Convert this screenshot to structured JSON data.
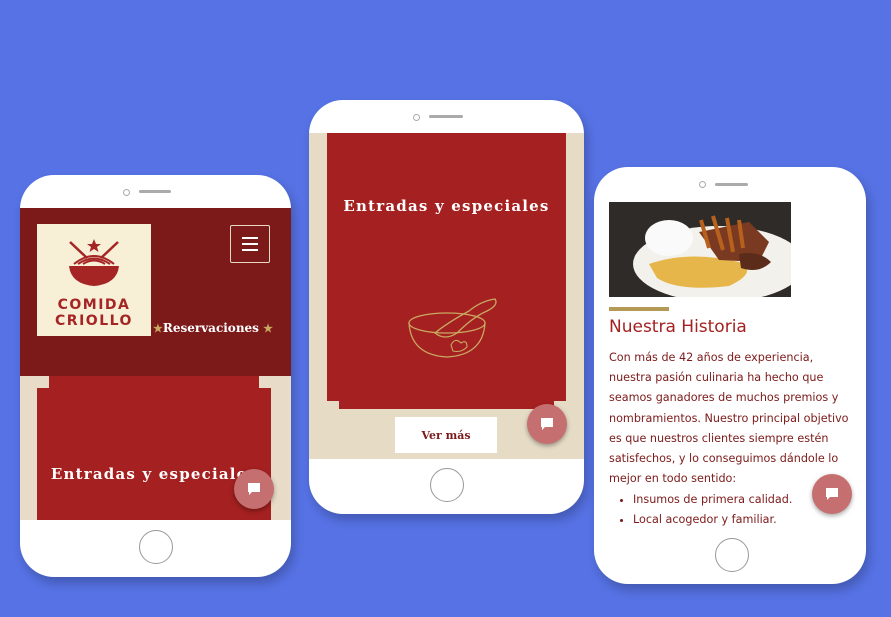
{
  "brand": {
    "logo_line1": "COMIDA",
    "logo_line2": "CRIOLLO",
    "primary_red": "#a52020",
    "dark_red": "#7c1a1a",
    "cream": "#f8efd7",
    "gold": "#b59a56",
    "background_blue": "#5672e4"
  },
  "phone1": {
    "nav_reservations": "Reservaciones",
    "menu_icon": "hamburger-menu-icon",
    "card_title": "Entradas y especiales",
    "chat_icon": "chat-icon"
  },
  "phone2": {
    "card_title": "Entradas y especiales",
    "card_icon": "bowl-spoon-icon",
    "button_label": "Ver más",
    "chat_icon": "chat-icon"
  },
  "phone3": {
    "section_title": "Nuestra Historia",
    "history_text": "Con más de 42 años de experiencia, nuestra pasión culinaria ha hecho que seamos ganadores de muchos premios y nombramientos. Nuestro principal objetivo es que nuestros clientes siempre estén satisfechos, y lo conseguimos dándole lo mejor en todo sentido:",
    "bullets": [
      "Insumos de primera calidad.",
      "Local acogedor y familiar."
    ],
    "chat_icon": "chat-icon"
  }
}
